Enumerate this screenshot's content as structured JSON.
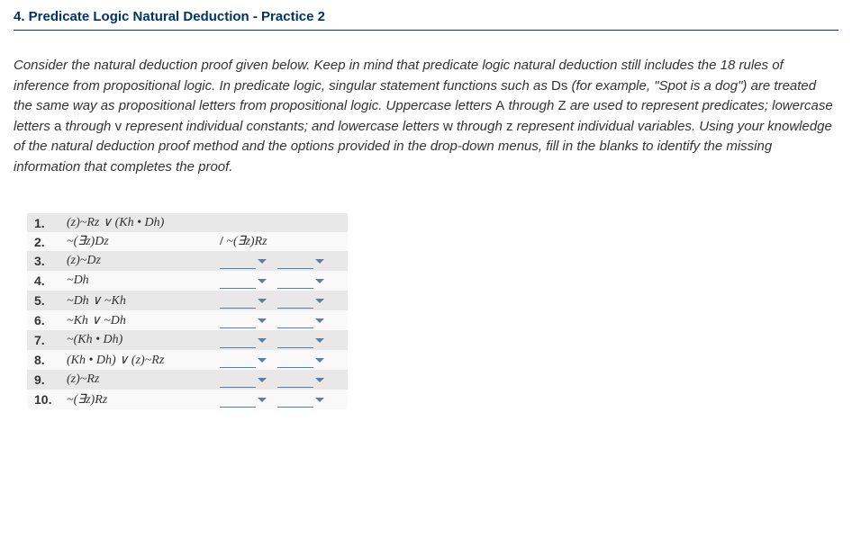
{
  "title": "4. Predicate Logic Natural Deduction - Practice 2",
  "instructions": {
    "part1": "Consider the natural deduction proof given below. Keep in mind that predicate logic natural deduction still includes the 18 rules of inference from propositional logic. In predicate logic, singular statement functions such as ",
    "ds": "Ds",
    "part2": " (for example, \"Spot is a dog\") are treated the same way as propositional letters from propositional logic. Uppercase letters ",
    "letters1": "A",
    "part3": " through ",
    "letters2": "Z",
    "part4": " are used to represent predicates; lowercase letters ",
    "letters3": "a",
    "part5": " through ",
    "letters4": "v",
    "part6": " represent individual constants; and lowercase letters ",
    "letters5": "w",
    "part7": " through ",
    "letters6": "z",
    "part8": " represent individual variables. Using your knowledge of the natural deduction proof method and the options provided in the drop-down menus, fill in the blanks to identify the missing information that completes the proof."
  },
  "proof": {
    "rows": [
      {
        "num": "1.",
        "formula": "(z)~Rz ∨ (Kh • Dh)",
        "conclusion": "",
        "hasDropdowns": false
      },
      {
        "num": "2.",
        "formula": "~(∃z)Dz",
        "conclusion": "/  ~(∃z)Rz",
        "hasDropdowns": false
      },
      {
        "num": "3.",
        "formula": "(z)~Dz",
        "conclusion": "",
        "hasDropdowns": true
      },
      {
        "num": "4.",
        "formula": "~Dh",
        "conclusion": "",
        "hasDropdowns": true
      },
      {
        "num": "5.",
        "formula": "~Dh ∨ ~Kh",
        "conclusion": "",
        "hasDropdowns": true
      },
      {
        "num": "6.",
        "formula": "~Kh ∨ ~Dh",
        "conclusion": "",
        "hasDropdowns": true
      },
      {
        "num": "7.",
        "formula": "~(Kh • Dh)",
        "conclusion": "",
        "hasDropdowns": true
      },
      {
        "num": "8.",
        "formula": "(Kh • Dh) ∨ (z)~Rz",
        "conclusion": "",
        "hasDropdowns": true
      },
      {
        "num": "9.",
        "formula": "(z)~Rz",
        "conclusion": "",
        "hasDropdowns": true
      },
      {
        "num": "10.",
        "formula": "~(∃z)Rz",
        "conclusion": "",
        "hasDropdowns": true
      }
    ]
  }
}
